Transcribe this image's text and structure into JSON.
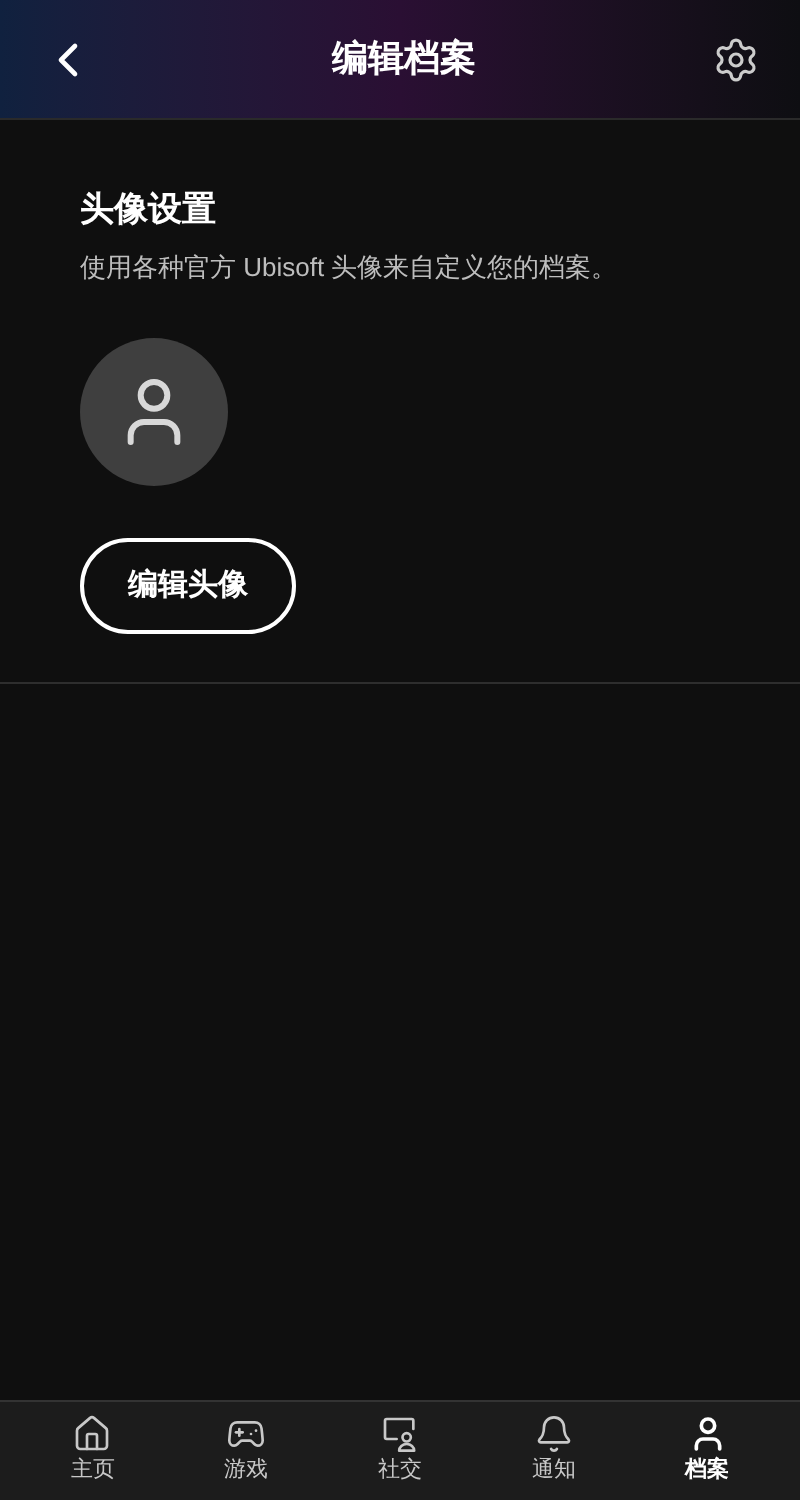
{
  "header": {
    "title": "编辑档案"
  },
  "avatar_section": {
    "title": "头像设置",
    "description": "使用各种官方 Ubisoft 头像来自定义您的档案。",
    "button": "编辑头像"
  },
  "tabs": [
    {
      "label": "主页",
      "selected": false
    },
    {
      "label": "游戏",
      "selected": false
    },
    {
      "label": "社交",
      "selected": false
    },
    {
      "label": "通知",
      "selected": false
    },
    {
      "label": "档案",
      "selected": true
    }
  ]
}
